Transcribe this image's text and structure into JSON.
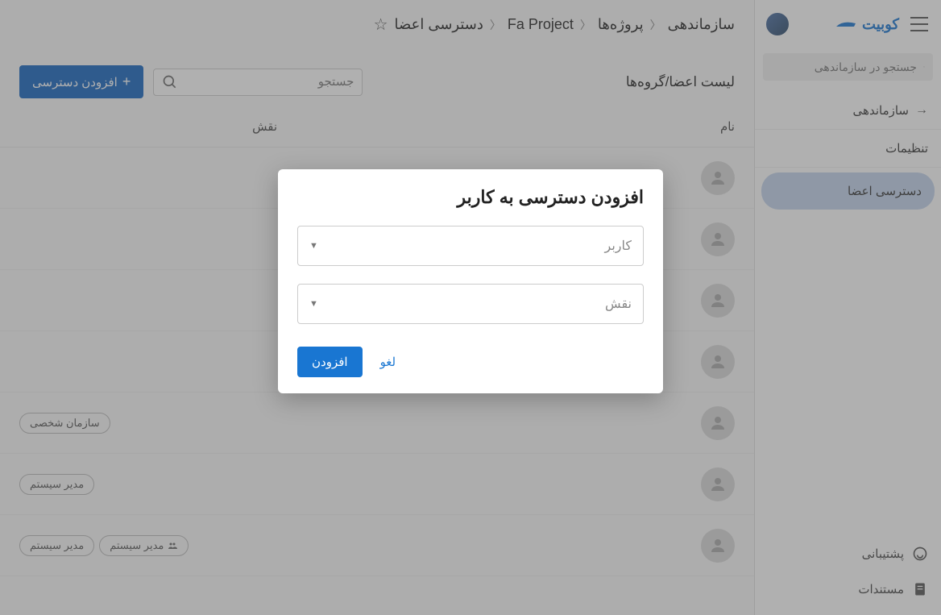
{
  "brand": "کوبیت",
  "sidebar": {
    "search_placeholder": "جستجو در سازماندهی",
    "items": [
      {
        "label": "سازماندهی",
        "arrow": true
      },
      {
        "label": "تنظیمات"
      },
      {
        "label": "دسترسی اعضا",
        "active": true
      }
    ],
    "footer": [
      {
        "label": "پشتیبانی"
      },
      {
        "label": "مستندات"
      }
    ]
  },
  "breadcrumb": [
    "سازماندهی",
    "پروژه‌ها",
    "Fa Project",
    "دسترسی اعضا"
  ],
  "content": {
    "title": "لیست اعضا/گروه‌ها",
    "search_placeholder": "جستجو",
    "add_button": "افزودن دسترسی",
    "columns": {
      "name": "نام",
      "role": "نقش"
    },
    "rows": [
      {
        "roles": []
      },
      {
        "roles": []
      },
      {
        "roles": []
      },
      {
        "roles": []
      },
      {
        "roles": [
          "سازمان شخصی"
        ]
      },
      {
        "roles": [
          "مدیر سیستم"
        ]
      },
      {
        "roles": [
          "مدیر سیستم"
        ],
        "group_role": "مدیر سیستم"
      }
    ]
  },
  "dialog": {
    "title": "افزودن دسترسی به کاربر",
    "user_label": "کاربر",
    "role_label": "نقش",
    "cancel": "لغو",
    "submit": "افزودن"
  }
}
